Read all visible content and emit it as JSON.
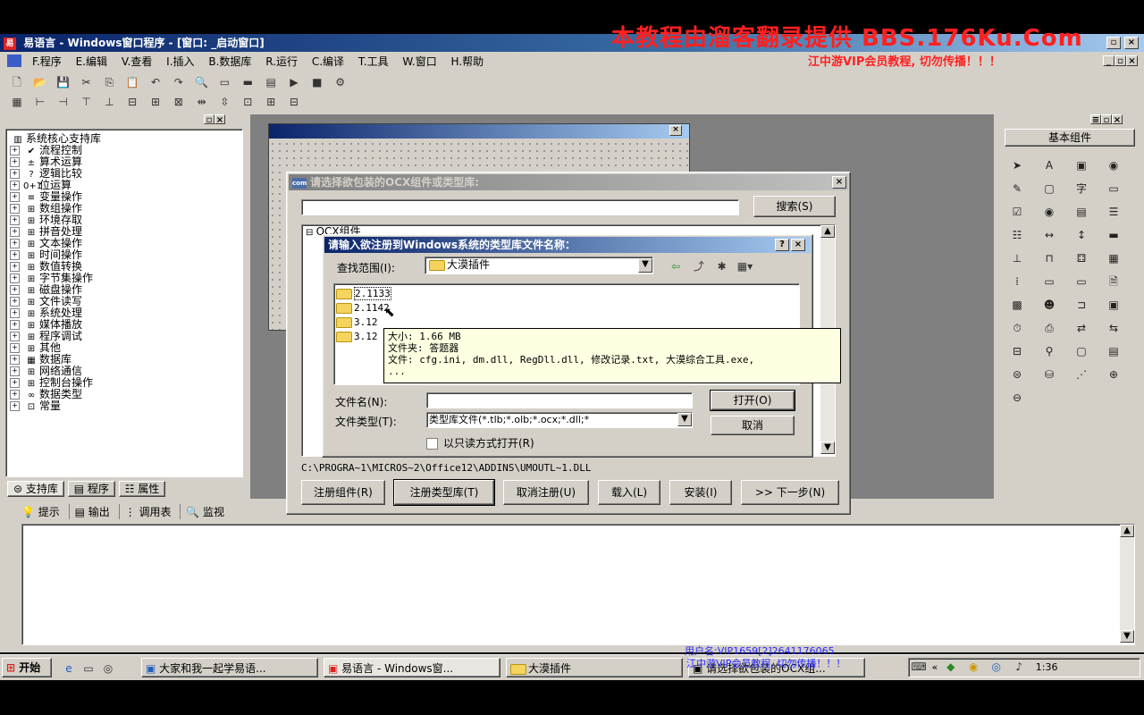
{
  "watermark": {
    "title": "本教程由溜客翻录提供 BBS.176Ku.Com",
    "subtitle": "江中游VIP会员教程, 切勿传播！！！",
    "user_line": "用户名:VIP1659[2]2641176065",
    "user_line2": "江中游VIP会员教程, 切勿传播！！！"
  },
  "main_window": {
    "title": "易语言 - Windows窗口程序 - [窗口: _启动窗口]",
    "menu": [
      "F.程序",
      "E.编辑",
      "V.查看",
      "I.插入",
      "B.数据库",
      "R.运行",
      "C.编译",
      "T.工具",
      "W.窗口",
      "H.帮助"
    ]
  },
  "left_panel": {
    "root": "系统核心支持库",
    "items": [
      {
        "icon": "✔",
        "label": "流程控制"
      },
      {
        "icon": "±",
        "label": "算术运算"
      },
      {
        "icon": "?",
        "label": "逻辑比较"
      },
      {
        "icon": "0+1",
        "label": "位运算"
      },
      {
        "icon": "≡",
        "label": "变量操作"
      },
      {
        "icon": "⊞",
        "label": "数组操作"
      },
      {
        "icon": "⊞",
        "label": "环境存取"
      },
      {
        "icon": "⊞",
        "label": "拼音处理"
      },
      {
        "icon": "⊞",
        "label": "文本操作"
      },
      {
        "icon": "⊞",
        "label": "时间操作"
      },
      {
        "icon": "⊞",
        "label": "数值转换"
      },
      {
        "icon": "⊞",
        "label": "字节集操作"
      },
      {
        "icon": "⊞",
        "label": "磁盘操作"
      },
      {
        "icon": "⊞",
        "label": "文件读写"
      },
      {
        "icon": "⊞",
        "label": "系统处理"
      },
      {
        "icon": "⊞",
        "label": "媒体播放"
      },
      {
        "icon": "⊞",
        "label": "程序调试"
      },
      {
        "icon": "⊞",
        "label": "其他"
      },
      {
        "icon": "▦",
        "label": "数据库"
      },
      {
        "icon": "⊞",
        "label": "网络通信"
      },
      {
        "icon": "⊞",
        "label": "控制台操作"
      },
      {
        "icon": "∞",
        "label": "数据类型"
      },
      {
        "icon": "⊡",
        "label": "常量"
      }
    ],
    "tabs": [
      "支持库",
      "程序",
      "属性"
    ]
  },
  "right_panel": {
    "title": "基本组件"
  },
  "bottom_panel": {
    "tabs": [
      "提示",
      "输出",
      "调用表",
      "监视"
    ]
  },
  "ocx_dialog": {
    "title": "请选择欲包装的OCX组件或类型库:",
    "search_button": "搜索(S)",
    "list_header": "OCX组件",
    "path": "C:\\PROGRA~1\\MICROS~2\\Office12\\ADDINS\\UMOUTL~1.DLL",
    "buttons": [
      "注册组件(R)",
      "注册类型库(T)",
      "取消注册(U)",
      "载入(L)",
      "安装(I)",
      ">> 下一步(N)"
    ]
  },
  "file_dialog": {
    "title": "请输入欲注册到Windows系统的类型库文件名称：",
    "lookin_label": "查找范围(I):",
    "lookin_value": "大漠插件",
    "folders": [
      "2.1133",
      "2.1142",
      "3.12",
      "3.12"
    ],
    "tooltip": {
      "size": "大小: 1.66 MB",
      "folder": "文件夹: 答题器",
      "files": "文件: cfg.ini, dm.dll, RegDll.dll, 修改记录.txt, 大漠综合工具.exe,",
      "more": "..."
    },
    "filename_label": "文件名(N):",
    "filename_value": "",
    "filetype_label": "文件类型(T):",
    "filetype_value": "类型库文件(*.tlb;*.olb;*.ocx;*.dll;*",
    "readonly_label": "以只读方式打开(R)",
    "open_button": "打开(O)",
    "cancel_button": "取消"
  },
  "taskbar": {
    "start": "开始",
    "items": [
      "大家和我一起学易语...",
      "易语言 - Windows窗...",
      "大漠插件",
      "请选择欲包装的OCX组..."
    ],
    "clock": "1:36"
  }
}
